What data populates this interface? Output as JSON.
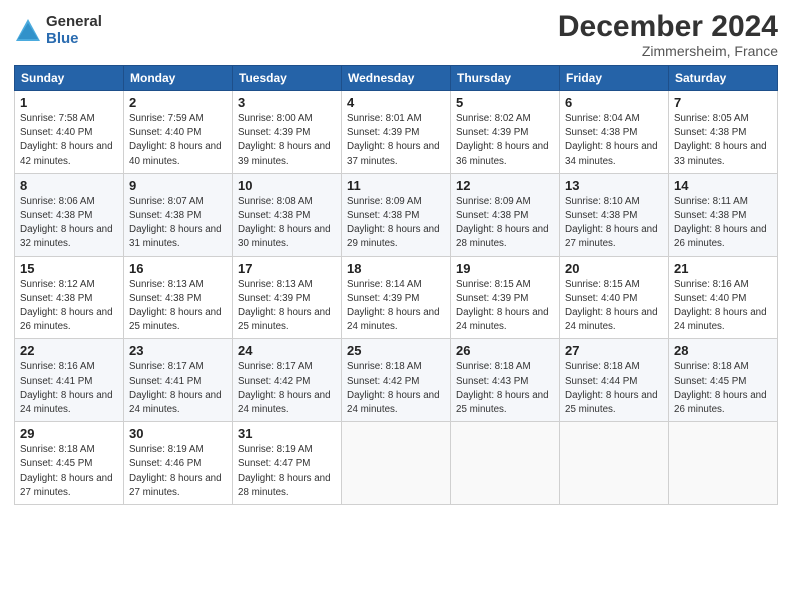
{
  "logo": {
    "general": "General",
    "blue": "Blue"
  },
  "title": "December 2024",
  "location": "Zimmersheim, France",
  "headers": [
    "Sunday",
    "Monday",
    "Tuesday",
    "Wednesday",
    "Thursday",
    "Friday",
    "Saturday"
  ],
  "weeks": [
    [
      {
        "day": "1",
        "sunrise": "7:58 AM",
        "sunset": "4:40 PM",
        "daylight": "8 hours and 42 minutes."
      },
      {
        "day": "2",
        "sunrise": "7:59 AM",
        "sunset": "4:40 PM",
        "daylight": "8 hours and 40 minutes."
      },
      {
        "day": "3",
        "sunrise": "8:00 AM",
        "sunset": "4:39 PM",
        "daylight": "8 hours and 39 minutes."
      },
      {
        "day": "4",
        "sunrise": "8:01 AM",
        "sunset": "4:39 PM",
        "daylight": "8 hours and 37 minutes."
      },
      {
        "day": "5",
        "sunrise": "8:02 AM",
        "sunset": "4:39 PM",
        "daylight": "8 hours and 36 minutes."
      },
      {
        "day": "6",
        "sunrise": "8:04 AM",
        "sunset": "4:38 PM",
        "daylight": "8 hours and 34 minutes."
      },
      {
        "day": "7",
        "sunrise": "8:05 AM",
        "sunset": "4:38 PM",
        "daylight": "8 hours and 33 minutes."
      }
    ],
    [
      {
        "day": "8",
        "sunrise": "8:06 AM",
        "sunset": "4:38 PM",
        "daylight": "8 hours and 32 minutes."
      },
      {
        "day": "9",
        "sunrise": "8:07 AM",
        "sunset": "4:38 PM",
        "daylight": "8 hours and 31 minutes."
      },
      {
        "day": "10",
        "sunrise": "8:08 AM",
        "sunset": "4:38 PM",
        "daylight": "8 hours and 30 minutes."
      },
      {
        "day": "11",
        "sunrise": "8:09 AM",
        "sunset": "4:38 PM",
        "daylight": "8 hours and 29 minutes."
      },
      {
        "day": "12",
        "sunrise": "8:09 AM",
        "sunset": "4:38 PM",
        "daylight": "8 hours and 28 minutes."
      },
      {
        "day": "13",
        "sunrise": "8:10 AM",
        "sunset": "4:38 PM",
        "daylight": "8 hours and 27 minutes."
      },
      {
        "day": "14",
        "sunrise": "8:11 AM",
        "sunset": "4:38 PM",
        "daylight": "8 hours and 26 minutes."
      }
    ],
    [
      {
        "day": "15",
        "sunrise": "8:12 AM",
        "sunset": "4:38 PM",
        "daylight": "8 hours and 26 minutes."
      },
      {
        "day": "16",
        "sunrise": "8:13 AM",
        "sunset": "4:38 PM",
        "daylight": "8 hours and 25 minutes."
      },
      {
        "day": "17",
        "sunrise": "8:13 AM",
        "sunset": "4:39 PM",
        "daylight": "8 hours and 25 minutes."
      },
      {
        "day": "18",
        "sunrise": "8:14 AM",
        "sunset": "4:39 PM",
        "daylight": "8 hours and 24 minutes."
      },
      {
        "day": "19",
        "sunrise": "8:15 AM",
        "sunset": "4:39 PM",
        "daylight": "8 hours and 24 minutes."
      },
      {
        "day": "20",
        "sunrise": "8:15 AM",
        "sunset": "4:40 PM",
        "daylight": "8 hours and 24 minutes."
      },
      {
        "day": "21",
        "sunrise": "8:16 AM",
        "sunset": "4:40 PM",
        "daylight": "8 hours and 24 minutes."
      }
    ],
    [
      {
        "day": "22",
        "sunrise": "8:16 AM",
        "sunset": "4:41 PM",
        "daylight": "8 hours and 24 minutes."
      },
      {
        "day": "23",
        "sunrise": "8:17 AM",
        "sunset": "4:41 PM",
        "daylight": "8 hours and 24 minutes."
      },
      {
        "day": "24",
        "sunrise": "8:17 AM",
        "sunset": "4:42 PM",
        "daylight": "8 hours and 24 minutes."
      },
      {
        "day": "25",
        "sunrise": "8:18 AM",
        "sunset": "4:42 PM",
        "daylight": "8 hours and 24 minutes."
      },
      {
        "day": "26",
        "sunrise": "8:18 AM",
        "sunset": "4:43 PM",
        "daylight": "8 hours and 25 minutes."
      },
      {
        "day": "27",
        "sunrise": "8:18 AM",
        "sunset": "4:44 PM",
        "daylight": "8 hours and 25 minutes."
      },
      {
        "day": "28",
        "sunrise": "8:18 AM",
        "sunset": "4:45 PM",
        "daylight": "8 hours and 26 minutes."
      }
    ],
    [
      {
        "day": "29",
        "sunrise": "8:18 AM",
        "sunset": "4:45 PM",
        "daylight": "8 hours and 27 minutes."
      },
      {
        "day": "30",
        "sunrise": "8:19 AM",
        "sunset": "4:46 PM",
        "daylight": "8 hours and 27 minutes."
      },
      {
        "day": "31",
        "sunrise": "8:19 AM",
        "sunset": "4:47 PM",
        "daylight": "8 hours and 28 minutes."
      },
      null,
      null,
      null,
      null
    ]
  ]
}
